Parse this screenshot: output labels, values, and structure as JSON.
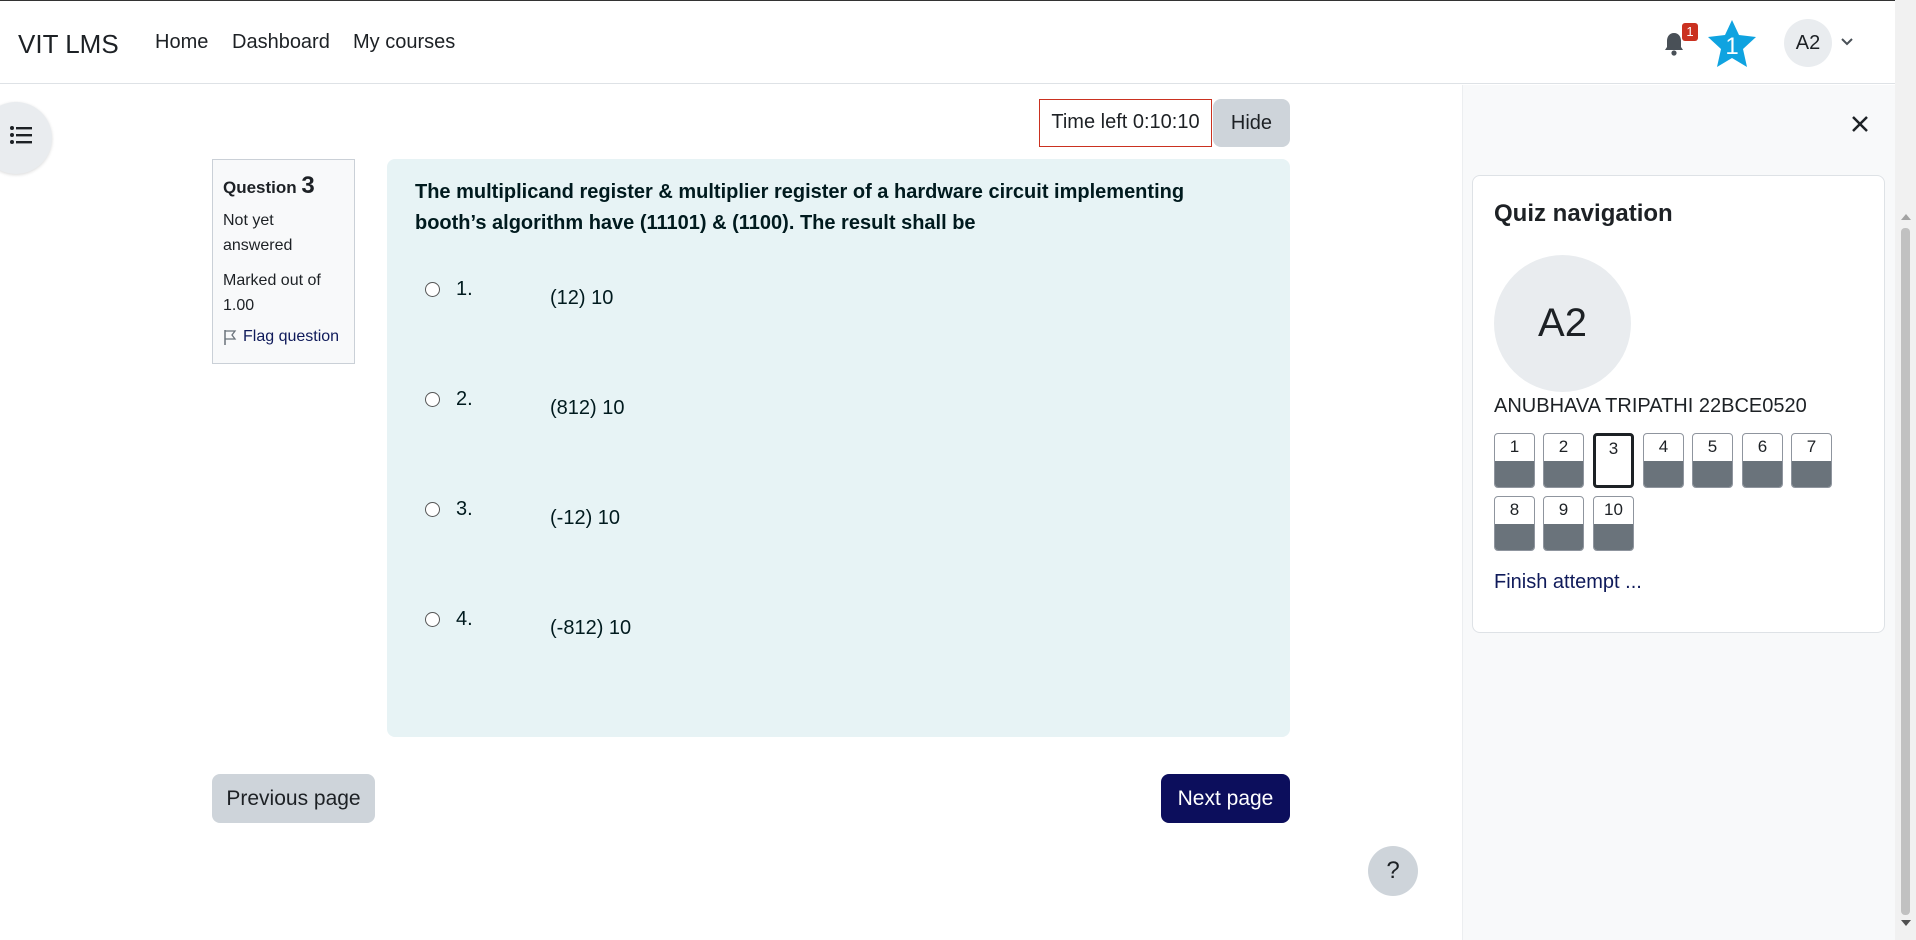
{
  "header": {
    "brand": "VIT LMS",
    "nav": [
      "Home",
      "Dashboard",
      "My courses"
    ],
    "notification_count": "1",
    "badge_level": "1",
    "user_initials": "A2"
  },
  "timer": {
    "label": "Time left 0:10:10",
    "hide_label": "Hide"
  },
  "question_info": {
    "question_word": "Question",
    "number": "3",
    "status": "Not yet answered",
    "marks": "Marked out of 1.00",
    "flag_label": "Flag question"
  },
  "question": {
    "text": "The multiplicand register & multiplier register of a hardware circuit implementing booth’s algorithm have (11101) & (1100). The result shall be",
    "answers": [
      {
        "num": "1.",
        "text": "(12) 10"
      },
      {
        "num": "2.",
        "text": "(812) 10"
      },
      {
        "num": "3.",
        "text": "(-12) 10"
      },
      {
        "num": "4.",
        "text": "(-812) 10"
      }
    ]
  },
  "page_nav": {
    "prev": "Previous page",
    "next": "Next page",
    "help": "?"
  },
  "quiz_nav": {
    "title": "Quiz navigation",
    "avatar": "A2",
    "student": "ANUBHAVA TRIPATHI 22BCE0520",
    "questions": [
      "1",
      "2",
      "3",
      "4",
      "5",
      "6",
      "7",
      "8",
      "9",
      "10"
    ],
    "current_question": "3",
    "finish": "Finish attempt ..."
  },
  "colors": {
    "accent": "#0c0e5c",
    "question_bg": "#e7f3f5",
    "timer_border": "#ca3120",
    "badge": "#ca3120",
    "star": "#0fa3e0"
  }
}
